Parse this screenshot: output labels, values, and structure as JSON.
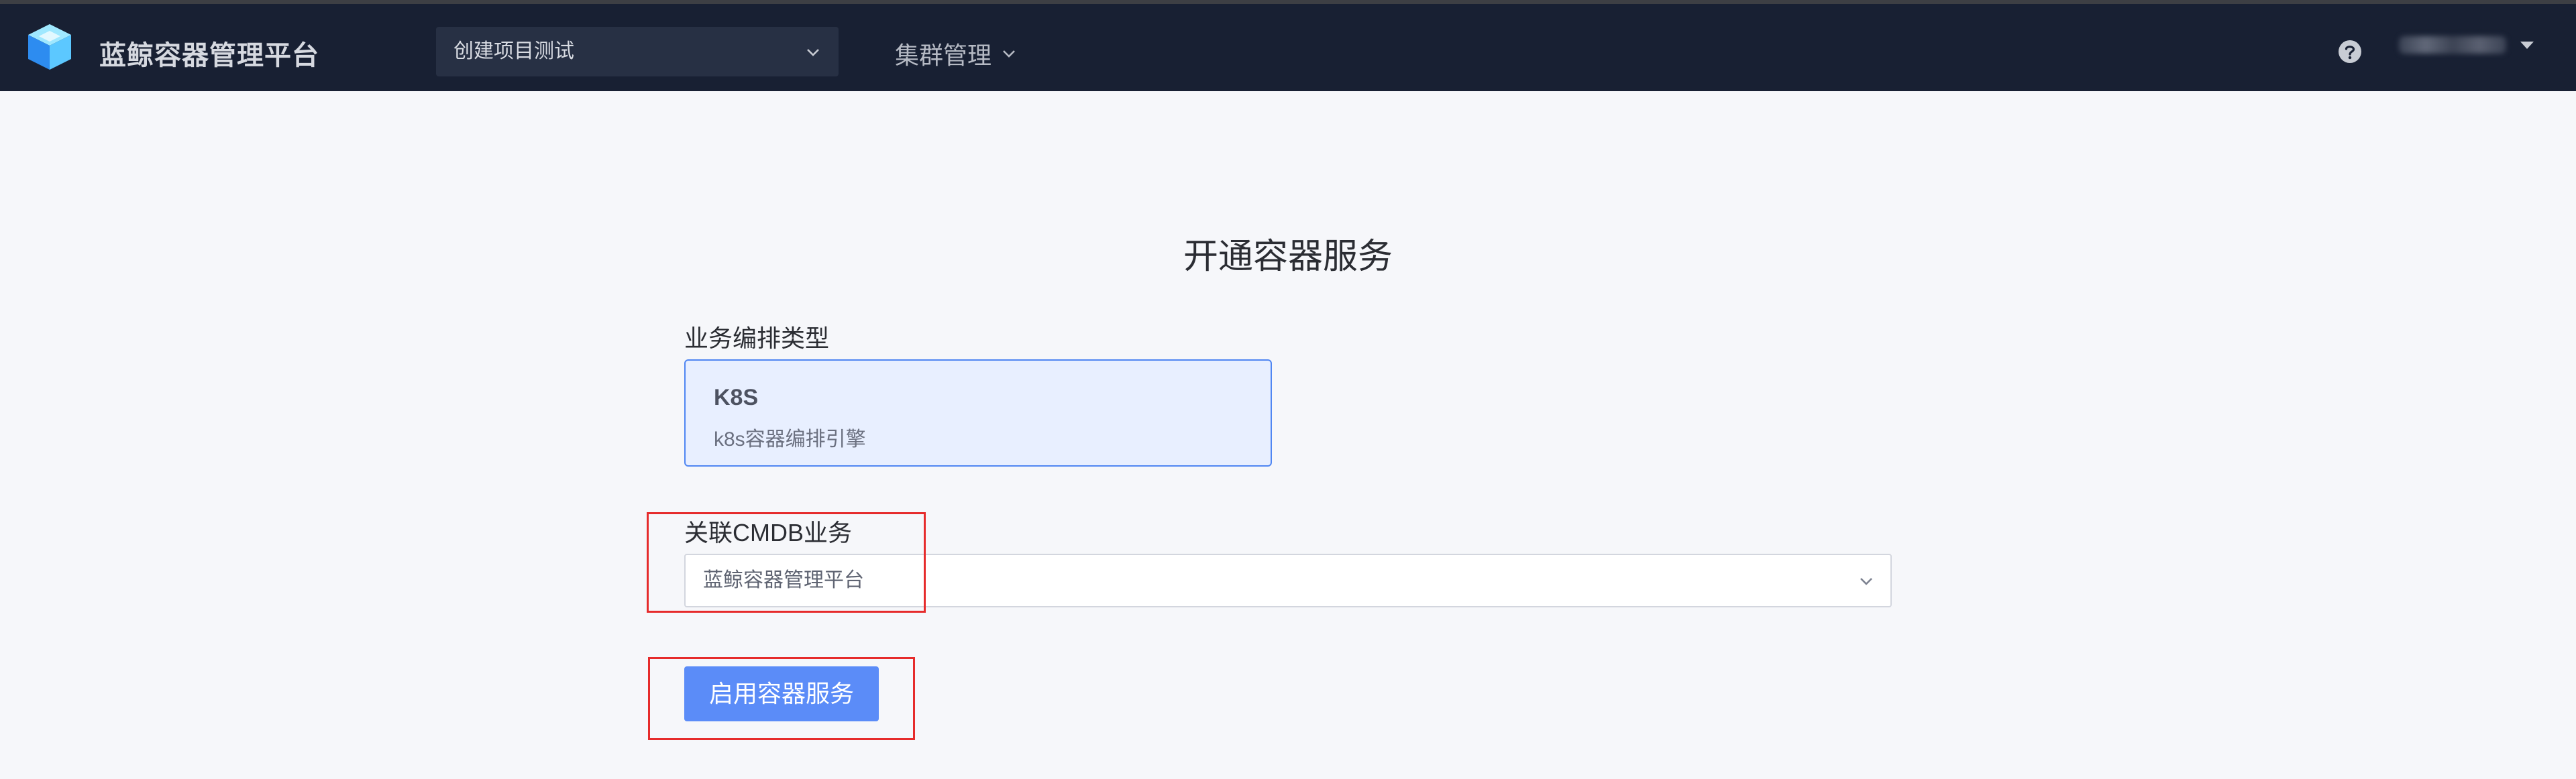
{
  "header": {
    "brand": "蓝鲸容器管理平台",
    "project_select": {
      "value": "创建项目测试"
    },
    "nav": {
      "cluster_label": "集群管理"
    }
  },
  "main": {
    "title": "开通容器服务",
    "orchestration": {
      "label": "业务编排类型",
      "option": {
        "title": "K8S",
        "description": "k8s容器编排引擎"
      }
    },
    "cmdb": {
      "label": "关联CMDB业务",
      "value": "蓝鲸容器管理平台"
    },
    "enable_button": "启用容器服务"
  },
  "colors": {
    "topbar": "#182033",
    "accent": "#5b8cf8",
    "card_bg": "#e8efff",
    "card_border": "#4f86f2",
    "highlight": "#e62b2b"
  },
  "icons": [
    "cube-logo-icon",
    "chevron-down-icon",
    "help-icon",
    "caret-down-icon"
  ]
}
